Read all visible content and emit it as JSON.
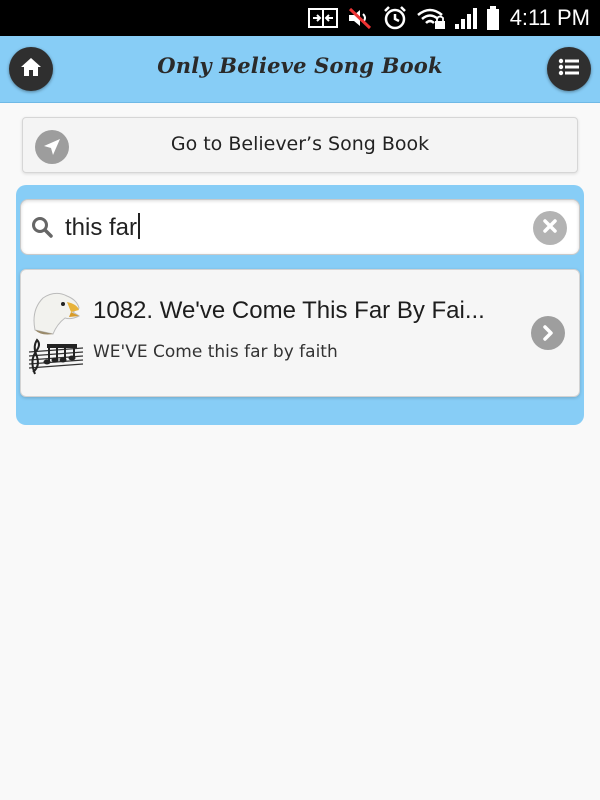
{
  "status_bar": {
    "time": "4:11 PM",
    "icons": [
      "screen-mirror-icon",
      "mute-icon",
      "alarm-icon",
      "wifi-lock-icon",
      "signal-icon",
      "battery-icon"
    ]
  },
  "header": {
    "title": "Only Believe Song Book",
    "left_icon": "home-icon",
    "right_icon": "list-menu-icon"
  },
  "goto_button": {
    "label": "Go to Believer’s Song Book",
    "icon": "navigation-arrow-icon"
  },
  "search": {
    "value": "this far",
    "icon": "search-icon",
    "clear_icon": "clear-icon"
  },
  "results": [
    {
      "title": "1082. We've Come This Far By Fai...",
      "subtitle": "WE'VE Come this far by faith",
      "thumbnail": "eagle-music-icon",
      "chevron": "chevron-right-icon"
    }
  ],
  "colors": {
    "header_bg": "#87cdf6",
    "panel_bg": "#87cdf6",
    "button_dark": "#2f2f2f",
    "icon_grey": "#9e9e9e"
  }
}
